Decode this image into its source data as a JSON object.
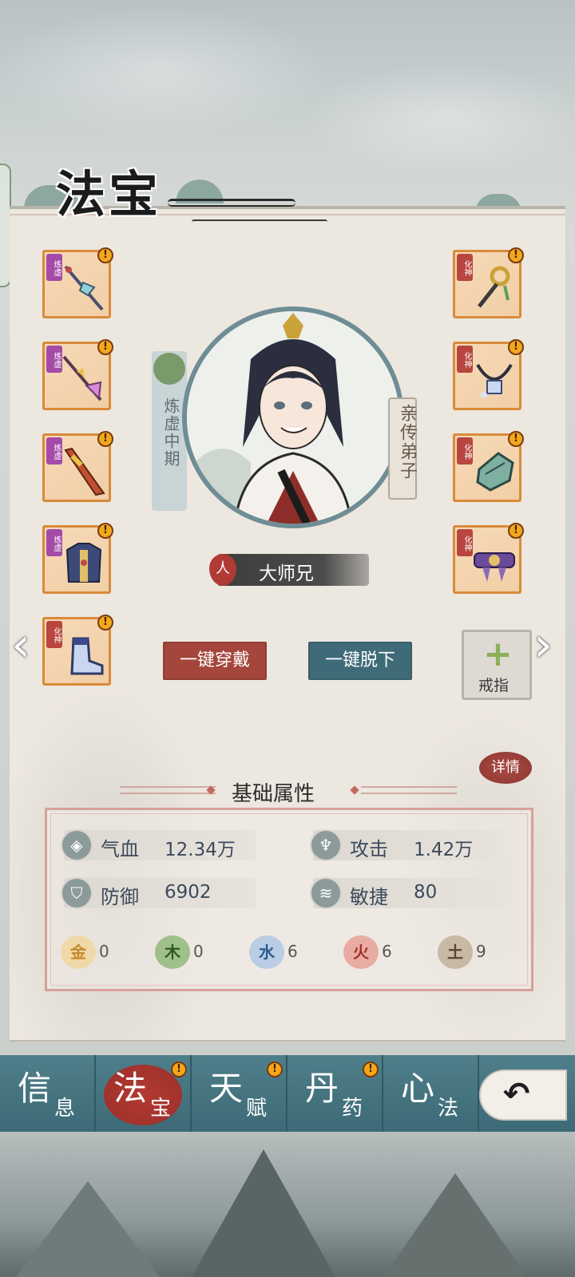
{
  "header": {
    "title": "法宝"
  },
  "character": {
    "realm": "炼虚中期",
    "rank": "亲传弟子",
    "race": "人",
    "name": "大师兄"
  },
  "slots_left": [
    {
      "tag": "炼虚",
      "icon": "spear-icon"
    },
    {
      "tag": "炼虚",
      "icon": "halberd-icon"
    },
    {
      "tag": "炼虚",
      "icon": "blade-icon"
    },
    {
      "tag": "炼虚",
      "icon": "armor-icon"
    },
    {
      "tag": "化神",
      "icon": "boots-icon"
    }
  ],
  "slots_right": [
    {
      "tag": "化神",
      "icon": "pendant-icon"
    },
    {
      "tag": "化神",
      "icon": "necklace-icon"
    },
    {
      "tag": "化神",
      "icon": "bracer-icon"
    },
    {
      "tag": "化神",
      "icon": "belt-icon"
    }
  ],
  "alert_mark": "!",
  "actions": {
    "equip_all": "一键穿戴",
    "unequip_all": "一键脱下",
    "ring_slot": "戒指",
    "plus": "+",
    "detail": "详情",
    "prev": "‹",
    "next": "›"
  },
  "stats": {
    "title": "基础属性",
    "hp": {
      "label": "气血",
      "value": "12.34万"
    },
    "atk": {
      "label": "攻击",
      "value": "1.42万"
    },
    "def": {
      "label": "防御",
      "value": "6902"
    },
    "agi": {
      "label": "敏捷",
      "value": "80"
    }
  },
  "elements": [
    {
      "glyph": "金",
      "value": "0",
      "color": "#e7b765"
    },
    {
      "glyph": "木",
      "value": "0",
      "color": "#79a65a"
    },
    {
      "glyph": "水",
      "value": "6",
      "color": "#7fa4c9"
    },
    {
      "glyph": "火",
      "value": "6",
      "color": "#d5786a"
    },
    {
      "glyph": "土",
      "value": "9",
      "color": "#a89680"
    }
  ],
  "tabs": [
    {
      "big": "信",
      "small": "息",
      "active": false,
      "alert": false
    },
    {
      "big": "法",
      "small": "宝",
      "active": true,
      "alert": true
    },
    {
      "big": "天",
      "small": "赋",
      "active": false,
      "alert": true
    },
    {
      "big": "丹",
      "small": "药",
      "active": false,
      "alert": true
    },
    {
      "big": "心",
      "small": "法",
      "active": false,
      "alert": false
    }
  ],
  "colors": {
    "slot_border": "#d98a3a",
    "equip_button": "#a4463b",
    "unequip_button": "#3f6b78",
    "tabbar": "#4f7f8a",
    "active_tab": "#b33a32"
  }
}
